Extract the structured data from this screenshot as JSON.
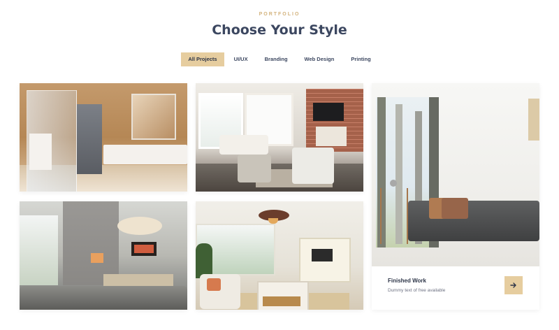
{
  "section": {
    "eyebrow": "PORTFOLIO",
    "title": "Choose Your Style"
  },
  "filters": [
    {
      "label": "All Projects",
      "active": true
    },
    {
      "label": "UI/UX",
      "active": false
    },
    {
      "label": "Branding",
      "active": false
    },
    {
      "label": "Web Design",
      "active": false
    },
    {
      "label": "Printing",
      "active": false
    }
  ],
  "featured": {
    "title": "Finished Work",
    "description": "Dummy text of free available",
    "button_icon": "arrow-right-icon"
  },
  "colors": {
    "accent": "#e6cd9f",
    "eyebrow": "#d3b37d",
    "heading": "#3c4760"
  }
}
